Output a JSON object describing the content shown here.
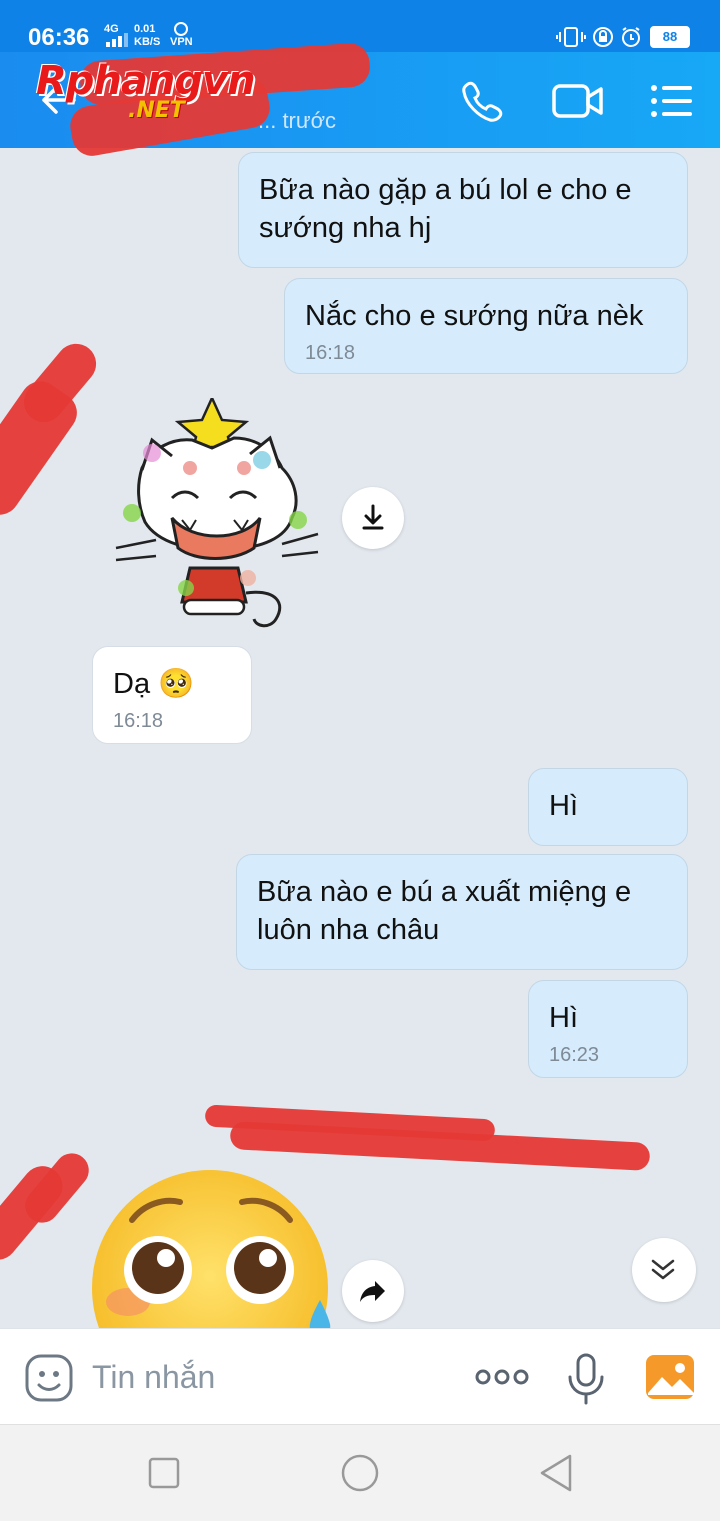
{
  "status_bar": {
    "time": "06:36",
    "network": "4G",
    "speed_value": "0.01",
    "speed_unit": "KB/S",
    "vpn": "VPN",
    "battery": "88"
  },
  "header": {
    "watermark": "Rphangvn",
    "watermark_sub": ".NET",
    "subtitle": "... trước"
  },
  "messages": [
    {
      "side": "out",
      "text": "Bữa nào gặp a bú lol e cho e sướng nha hj",
      "time": ""
    },
    {
      "side": "out",
      "text": "Nắc cho e sướng nữa nèk",
      "time": "16:18"
    },
    {
      "side": "in",
      "type": "sticker",
      "sticker": "cat-christmas-sticker"
    },
    {
      "side": "in",
      "text": "Dạ 🥺",
      "time": "16:18"
    },
    {
      "side": "out",
      "text": "Hì",
      "time": ""
    },
    {
      "side": "out",
      "text": "Bữa nào e bú a xuất miệng e luôn nha châu",
      "time": ""
    },
    {
      "side": "out",
      "text": "Hì",
      "time": "16:23"
    },
    {
      "side": "in",
      "type": "sticker",
      "sticker": "pleading-face-emoji-sticker"
    }
  ],
  "input": {
    "placeholder": "Tin nhắn",
    "more_label": "ooo"
  },
  "colors": {
    "header": "#1a8cf0",
    "outgoing_bubble": "#d6ecfc",
    "chat_bg": "#e2e8ee",
    "redaction": "#e53935"
  }
}
